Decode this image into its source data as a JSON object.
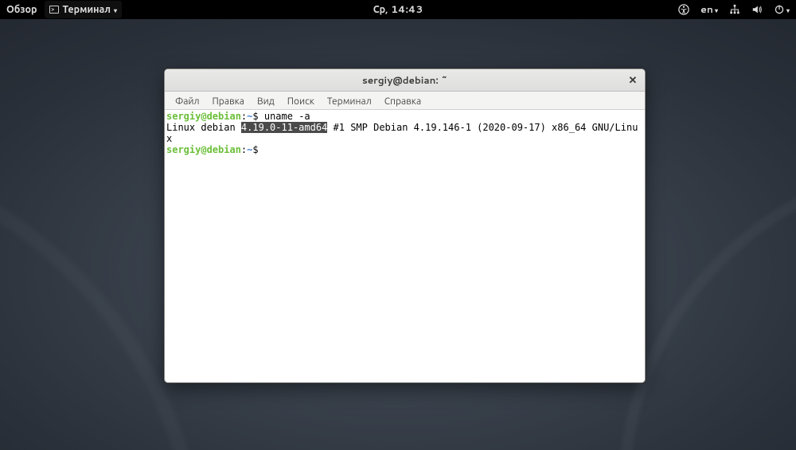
{
  "topbar": {
    "activities": "Обзор",
    "app_name": "Терминал",
    "clock": "Ср, 14:43",
    "lang": "en"
  },
  "window": {
    "title": "sergiy@debian: ~",
    "menu": {
      "file": "Файл",
      "edit": "Правка",
      "view": "Вид",
      "search": "Поиск",
      "terminal": "Терминал",
      "help": "Справка"
    }
  },
  "terminal": {
    "prompt_user": "sergiy@debian",
    "prompt_sep": ":",
    "prompt_path": "~",
    "prompt_sym": "$",
    "command1": "uname -a",
    "output_pre": "Linux debian ",
    "output_hl": "4.19.0-11-amd64",
    "output_post": " #1 SMP Debian 4.19.146-1 (2020-09-17) x86_64 GNU/Linux"
  }
}
